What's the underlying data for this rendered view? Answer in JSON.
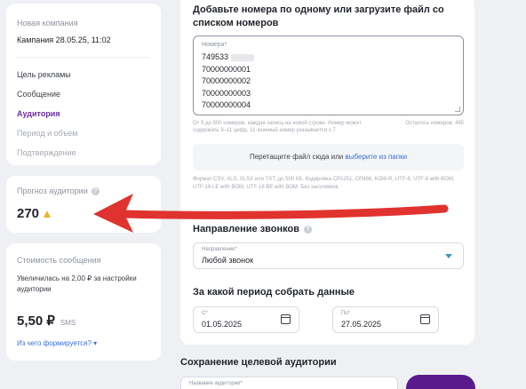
{
  "sidebar": {
    "new_campaign_label": "Новая компания",
    "campaign_name": "Кампания 28.05.25, 11:02",
    "items": [
      {
        "label": "Цель рекламы",
        "state": "normal"
      },
      {
        "label": "Сообщение",
        "state": "normal"
      },
      {
        "label": "Аудитория",
        "state": "active"
      },
      {
        "label": "Период и объем",
        "state": "disabled"
      },
      {
        "label": "Подтверждение",
        "state": "disabled"
      }
    ]
  },
  "forecast": {
    "title": "Прогноз аудитории",
    "value": "270"
  },
  "cost": {
    "title": "Стоимость сообщения",
    "description": "Увеличилась на 2,00 ₽ за настройки аудитории",
    "price": "5,50 ₽",
    "unit": "SMS",
    "link": "Из чего формируется?"
  },
  "main": {
    "numbers_title": "Добавьте номера по одному или загрузите файл со списком номеров",
    "numbers_field_label": "Номера*",
    "numbers": [
      "749533",
      "70000000001",
      "70000000002",
      "70000000003",
      "70000000004"
    ],
    "hint_left": "От 5 до 500 номеров, каждая запись на новой строке. Номер может содержать 3–11 цифр, 11-значный номер указывается с 7",
    "hint_right": "Осталось номеров: 495",
    "drop_text": "Перетащите файл сюда или",
    "drop_link": "выберите из папки",
    "format_text": "Формат CSV, XLS, XLSX или TXT, до 500 КБ. Кодировка CP1251, CP866, KOI8-R, UTF-8, UTF-8 with BOM, UTF-16 LE with BOM, UTF-16 BE with BOM. Без заголовков",
    "direction_title": "Направление звонков",
    "direction_label": "Направление*",
    "direction_value": "Любой звонок",
    "period_title": "За какой период собрать данные",
    "from_label": "С*",
    "from_value": "01.05.2025",
    "to_label": "По*",
    "to_value": "27.05.2025"
  },
  "save": {
    "title": "Сохранение целевой аудитории",
    "name_label": "Название аудитории*"
  },
  "colors": {
    "accent": "#6b2fa3",
    "button": "#5b1a8c",
    "arrow": "#e0332f",
    "link": "#3b6fd6"
  }
}
